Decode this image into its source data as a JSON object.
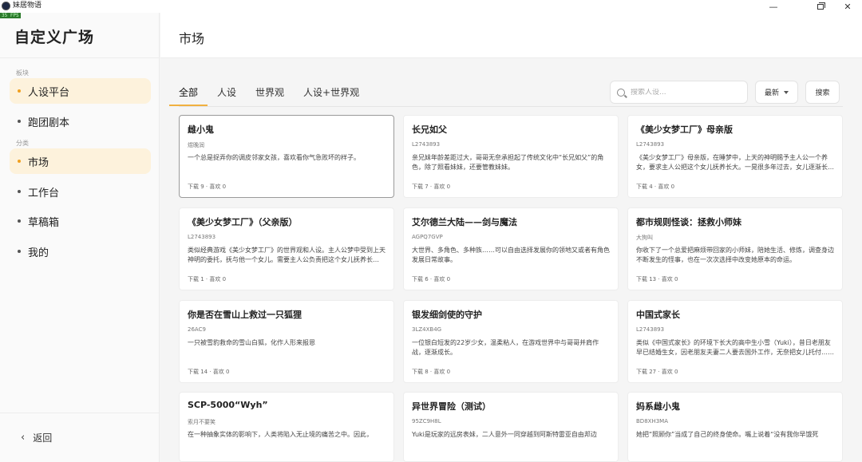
{
  "window": {
    "title": "妹居物语",
    "fps": "35 FPS"
  },
  "sidebar": {
    "title": "自定义广场",
    "section_boards": "板块",
    "section_category": "分类",
    "items": [
      {
        "label": "人设平台",
        "active": true
      },
      {
        "label": "跑团剧本",
        "active": false
      },
      {
        "label": "市场",
        "active": true
      },
      {
        "label": "工作台",
        "active": false
      },
      {
        "label": "草稿箱",
        "active": false
      },
      {
        "label": "我的",
        "active": false
      }
    ],
    "back_label": "返回"
  },
  "main": {
    "title": "市场",
    "tabs": [
      "全部",
      "人设",
      "世界观",
      "人设+世界观"
    ],
    "active_tab": 0,
    "search_placeholder": "搜索人设...",
    "sort_label": "最新",
    "search_button": "搜索"
  },
  "cards": [
    {
      "title": "雌小鬼",
      "author": "煜晚润",
      "desc": "一个总是捉弄你的调皮邻家女孩，喜欢看你气急败坏的样子。",
      "stats": "下载 9 · 喜欢 0"
    },
    {
      "title": "长兄如父",
      "author": "L2743893",
      "desc": "亲兄妹年龄差距过大，哥哥无奈承担起了传统文化中“长兄如父”的角色，除了照看妹妹，还要管教妹妹。",
      "stats": "下载 7 · 喜欢 0"
    },
    {
      "title": "《美少女梦工厂》母亲版",
      "author": "L2743893",
      "desc": "《美少女梦工厂》母亲版，在睡梦中，上天的神明赐予主人公一个养女，要求主人公把这个女儿抚养长大。一晃很多年过去，女儿逐渐长大……",
      "stats": "下载 4 · 喜欢 0"
    },
    {
      "title": "《美少女梦工厂》（父亲版）",
      "author": "L2743893",
      "desc": "类似经典游戏《美少女梦工厂》的世界观和人设。主人公梦中受到上天神明的委托，抚与他一个女儿。需要主人公负责把这个女儿抚养长大……",
      "stats": "下载 1 · 喜欢 0"
    },
    {
      "title": "艾尔德兰大陆——剑与魔法",
      "author": "AGPQ7GVP",
      "desc": "大世界、多角色、多种族……可以自由选择发展你的领地又或者有角色发展日常故事。",
      "stats": "下载 6 · 喜欢 0"
    },
    {
      "title": "都市规则怪谈：拯救小师妹",
      "author": "大狗叫",
      "desc": "你收下了一个总爱把麻烦带回家的小师妹，陪她生活、修炼，调查身边不断发生的怪事，也在一次次选择中改变她原本的命运。",
      "stats": "下载 13 · 喜欢 0"
    },
    {
      "title": "你是否在雪山上救过一只狐狸",
      "author": "26AC9",
      "desc": "一只被雪豹救命的雪山白狐，化作人形来报恩",
      "stats": "下载 14 · 喜欢 0"
    },
    {
      "title": "银发细剑使的守护",
      "author": "3LZ4XB4G",
      "desc": "一位银白短发的22岁少女，温柔粘人，在游戏世界中与哥哥并肩作战，逐渐成长。",
      "stats": "下载 8 · 喜欢 0"
    },
    {
      "title": "中国式家长",
      "author": "L2743893",
      "desc": "类似《中国式家长》的环境下长大的高中生小雪（Yuki），昔日老朋友早已结婚生女，因老朋友夫妻二人要去国外工作，无奈把女儿托付……",
      "stats": "下载 27 · 喜欢 0"
    },
    {
      "title": "SCP-5000“Wyh”",
      "author": "索月不要笑",
      "desc": "在一种抽象实体的影响下，人类将陷入无止境的痛苦之中。因此，",
      "stats": ""
    },
    {
      "title": "异世界冒险（测试）",
      "author": "95ZC9H8L",
      "desc": "Yuki是玩家的远房表妹，二人意外一同穿越到阿斯特雷亚自由邦边",
      "stats": ""
    },
    {
      "title": "妈系雌小鬼",
      "author": "BD8XH3MA",
      "desc": "她把“照顾你”当成了自己的终身使命。嘴上说着“没有我你早饿死",
      "stats": ""
    }
  ]
}
